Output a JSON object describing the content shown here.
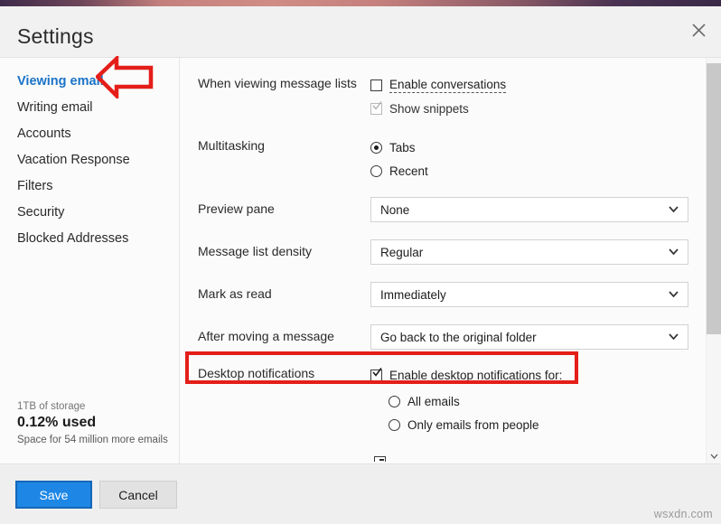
{
  "window": {
    "title": "Settings",
    "close_icon": "close-icon",
    "accent_left": "#3e2b4a",
    "accent_mid": "#d08d85"
  },
  "sidebar": {
    "items": [
      {
        "label": "Viewing email",
        "active": true
      },
      {
        "label": "Writing email",
        "active": false
      },
      {
        "label": "Accounts",
        "active": false
      },
      {
        "label": "Vacation Response",
        "active": false
      },
      {
        "label": "Filters",
        "active": false
      },
      {
        "label": "Security",
        "active": false
      },
      {
        "label": "Blocked Addresses",
        "active": false
      }
    ],
    "storage": {
      "capacity": "1TB of storage",
      "used": "0.12% used",
      "remaining": "Space for 54 million more emails"
    }
  },
  "main": {
    "rows": {
      "viewing_message_lists": {
        "label": "When viewing message lists",
        "enable_conversations": "Enable conversations",
        "show_snippets": "Show snippets"
      },
      "multitasking": {
        "label": "Multitasking",
        "tabs": "Tabs",
        "recent": "Recent"
      },
      "preview_pane": {
        "label": "Preview pane",
        "value": "None"
      },
      "message_list_density": {
        "label": "Message list density",
        "value": "Regular"
      },
      "mark_as_read": {
        "label": "Mark as read",
        "value": "Immediately"
      },
      "after_moving": {
        "label": "After moving a message",
        "value": "Go back to the original folder"
      },
      "desktop_notifications": {
        "label": "Desktop notifications",
        "enable_label": "Enable desktop notifications for:",
        "all_emails": "All emails",
        "only_people": "Only emails from people"
      }
    }
  },
  "footer": {
    "save_label": "Save",
    "cancel_label": "Cancel",
    "watermark": "wsxdn.com"
  },
  "annotations": {
    "arrow_color": "#e41e19",
    "box_color": "#e41e19"
  }
}
